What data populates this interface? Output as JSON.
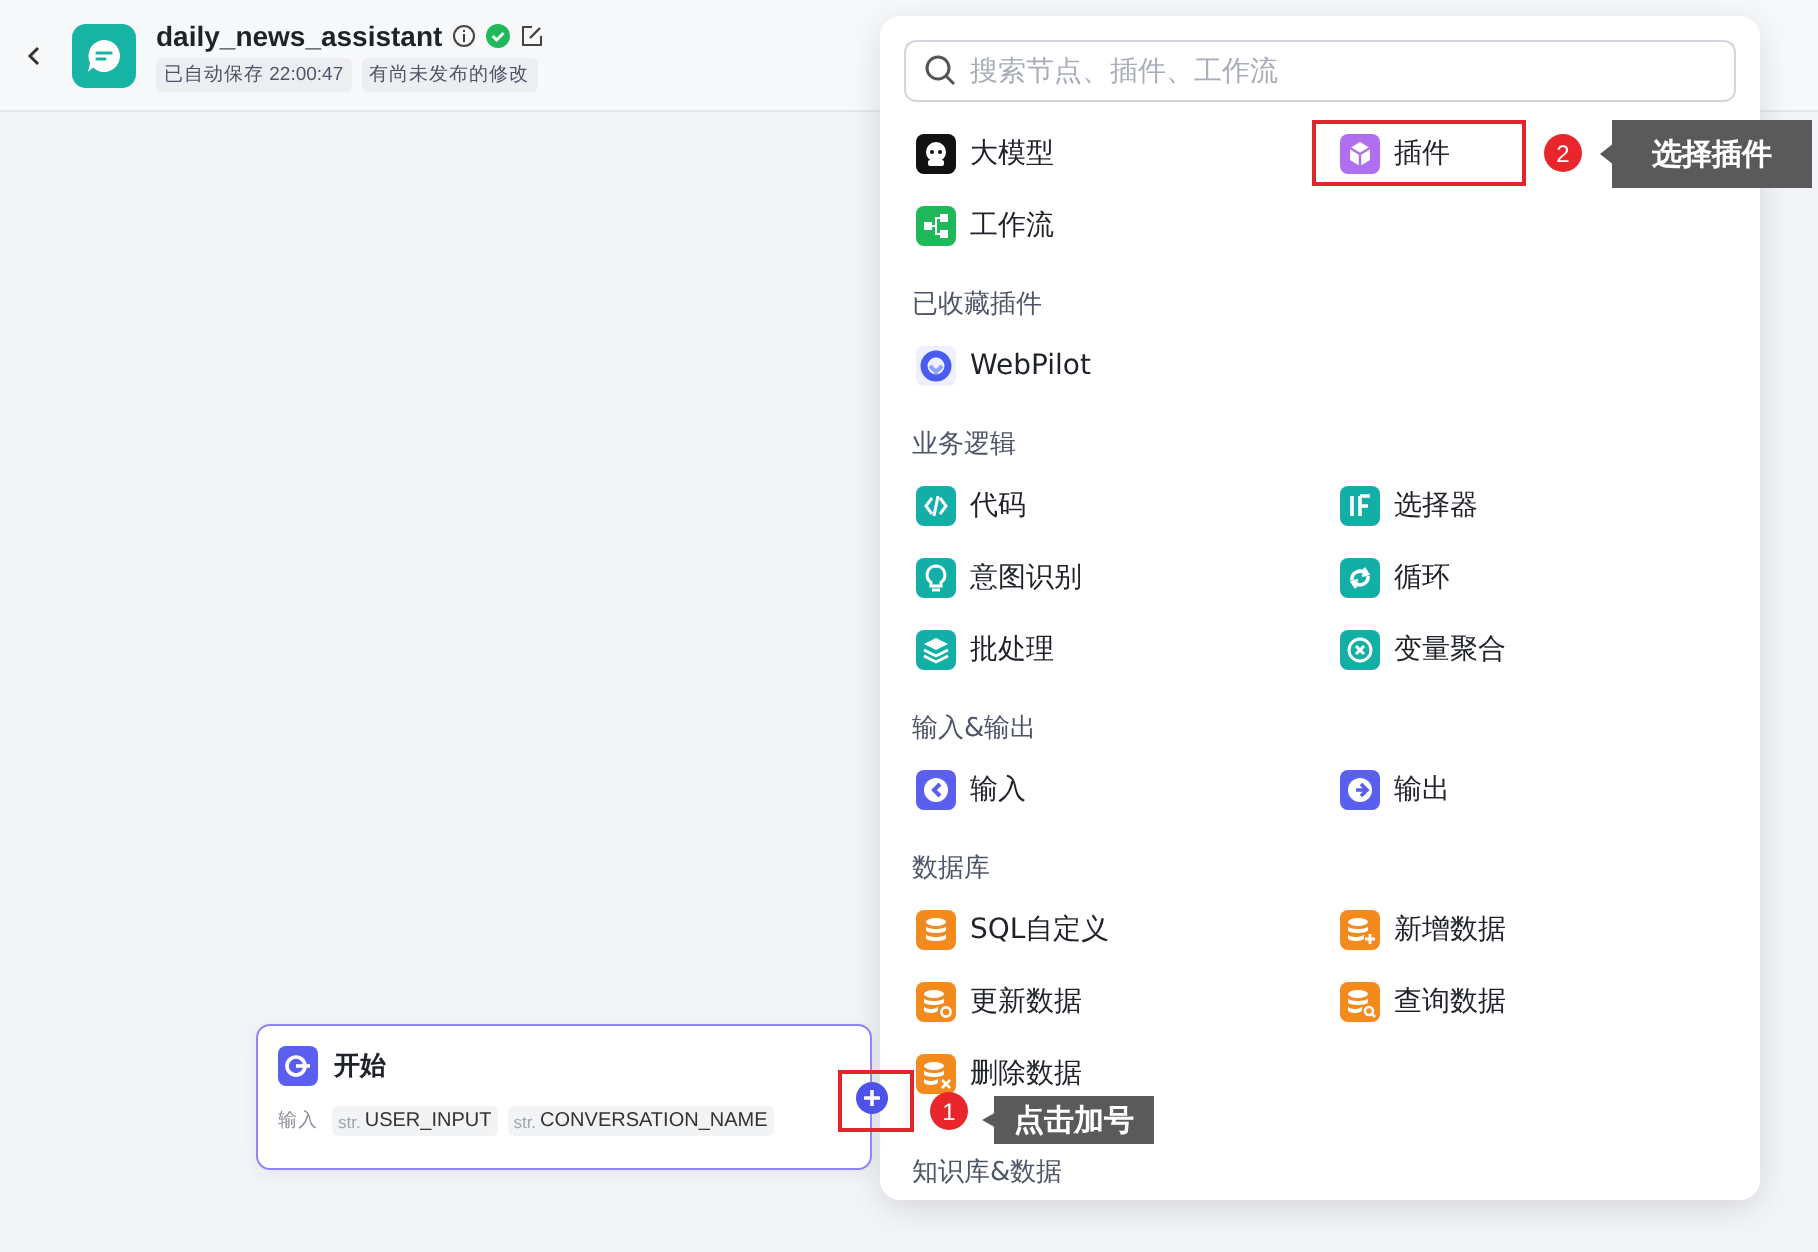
{
  "header": {
    "title": "daily_news_assistant",
    "tags": [
      "已自动保存 22:00:47",
      "有尚未发布的修改"
    ],
    "published_ok": true
  },
  "node_menu": {
    "search": {
      "placeholder": "搜索节点、插件、工作流"
    },
    "sections": [
      {
        "items": [
          {
            "kind": "llm",
            "label": "大模型"
          },
          {
            "kind": "plugin",
            "label": "插件",
            "annotation": {
              "number": "2",
              "text": "选择插件"
            }
          },
          {
            "kind": "workflow",
            "label": "工作流"
          }
        ]
      },
      {
        "title": "已收藏插件",
        "items": [
          {
            "kind": "webpilot",
            "label": "WebPilot"
          }
        ]
      },
      {
        "title": "业务逻辑",
        "items": [
          {
            "kind": "code",
            "label": "代码"
          },
          {
            "kind": "selector",
            "label": "选择器"
          },
          {
            "kind": "intent",
            "label": "意图识别"
          },
          {
            "kind": "loop",
            "label": "循环"
          },
          {
            "kind": "batch",
            "label": "批处理"
          },
          {
            "kind": "aggregate",
            "label": "变量聚合"
          }
        ]
      },
      {
        "title": "输入&输出",
        "items": [
          {
            "kind": "input",
            "label": "输入"
          },
          {
            "kind": "output",
            "label": "输出"
          }
        ]
      },
      {
        "title": "数据库",
        "items": [
          {
            "kind": "sql",
            "label": "SQL自定义"
          },
          {
            "kind": "insert",
            "label": "新增数据"
          },
          {
            "kind": "update",
            "label": "更新数据"
          },
          {
            "kind": "query",
            "label": "查询数据"
          },
          {
            "kind": "delete",
            "label": "删除数据"
          }
        ]
      },
      {
        "title": "知识库&数据"
      }
    ]
  },
  "start_node": {
    "title": "开始",
    "inputs_label": "输入",
    "inputs": [
      {
        "type": "str.",
        "name": "USER_INPUT"
      },
      {
        "type": "str.",
        "name": "CONVERSATION_NAME"
      }
    ],
    "add_port": {
      "annotation": {
        "number": "1",
        "text": "点击加号"
      }
    }
  }
}
